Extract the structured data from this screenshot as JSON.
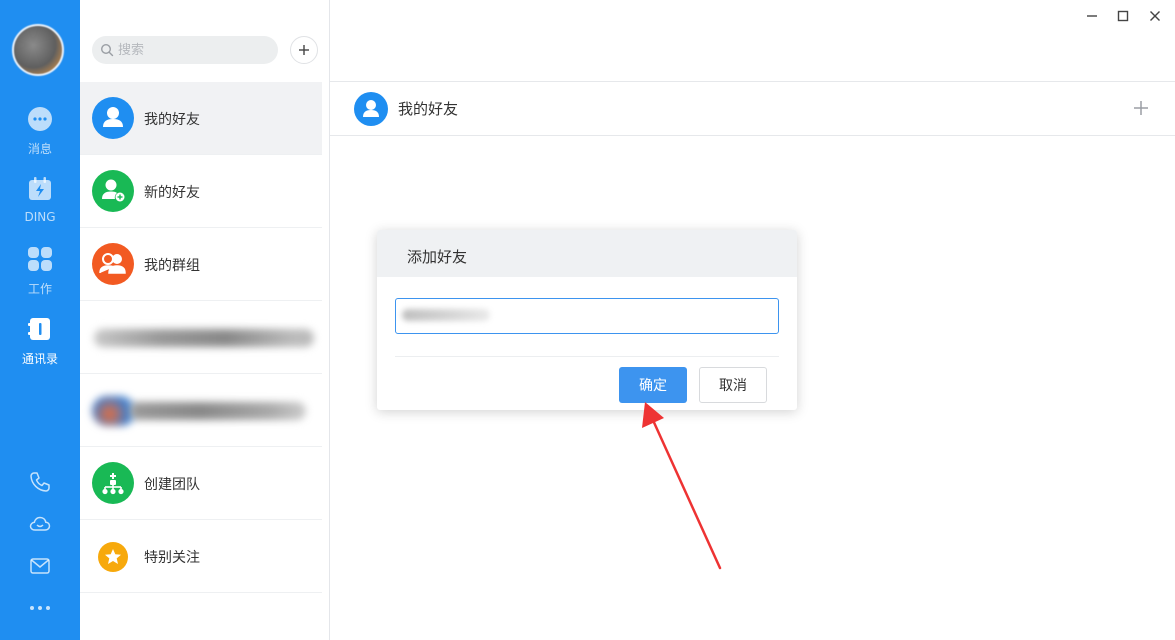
{
  "rail": {
    "items": [
      {
        "label": "消息",
        "icon": "chat-icon"
      },
      {
        "label": "DING",
        "icon": "ding-icon"
      },
      {
        "label": "工作",
        "icon": "apps-grid-icon"
      },
      {
        "label": "通讯录",
        "icon": "contacts-icon"
      }
    ],
    "accent": "#1f8ef1"
  },
  "search": {
    "placeholder": "搜索"
  },
  "contacts": {
    "my_friends": "我的好友",
    "new_friends": "新的好友",
    "my_groups": "我的群组",
    "create_team": "创建团队",
    "special_follow": "特别关注"
  },
  "main": {
    "header_title": "我的好友"
  },
  "dialog": {
    "title": "添加好友",
    "confirm_label": "确定",
    "cancel_label": "取消"
  },
  "colors": {
    "blue": "#1f8ef1",
    "green": "#19b955",
    "orange": "#f25a22",
    "yellow": "#f7a90c",
    "annotation_red": "#ee3333"
  }
}
